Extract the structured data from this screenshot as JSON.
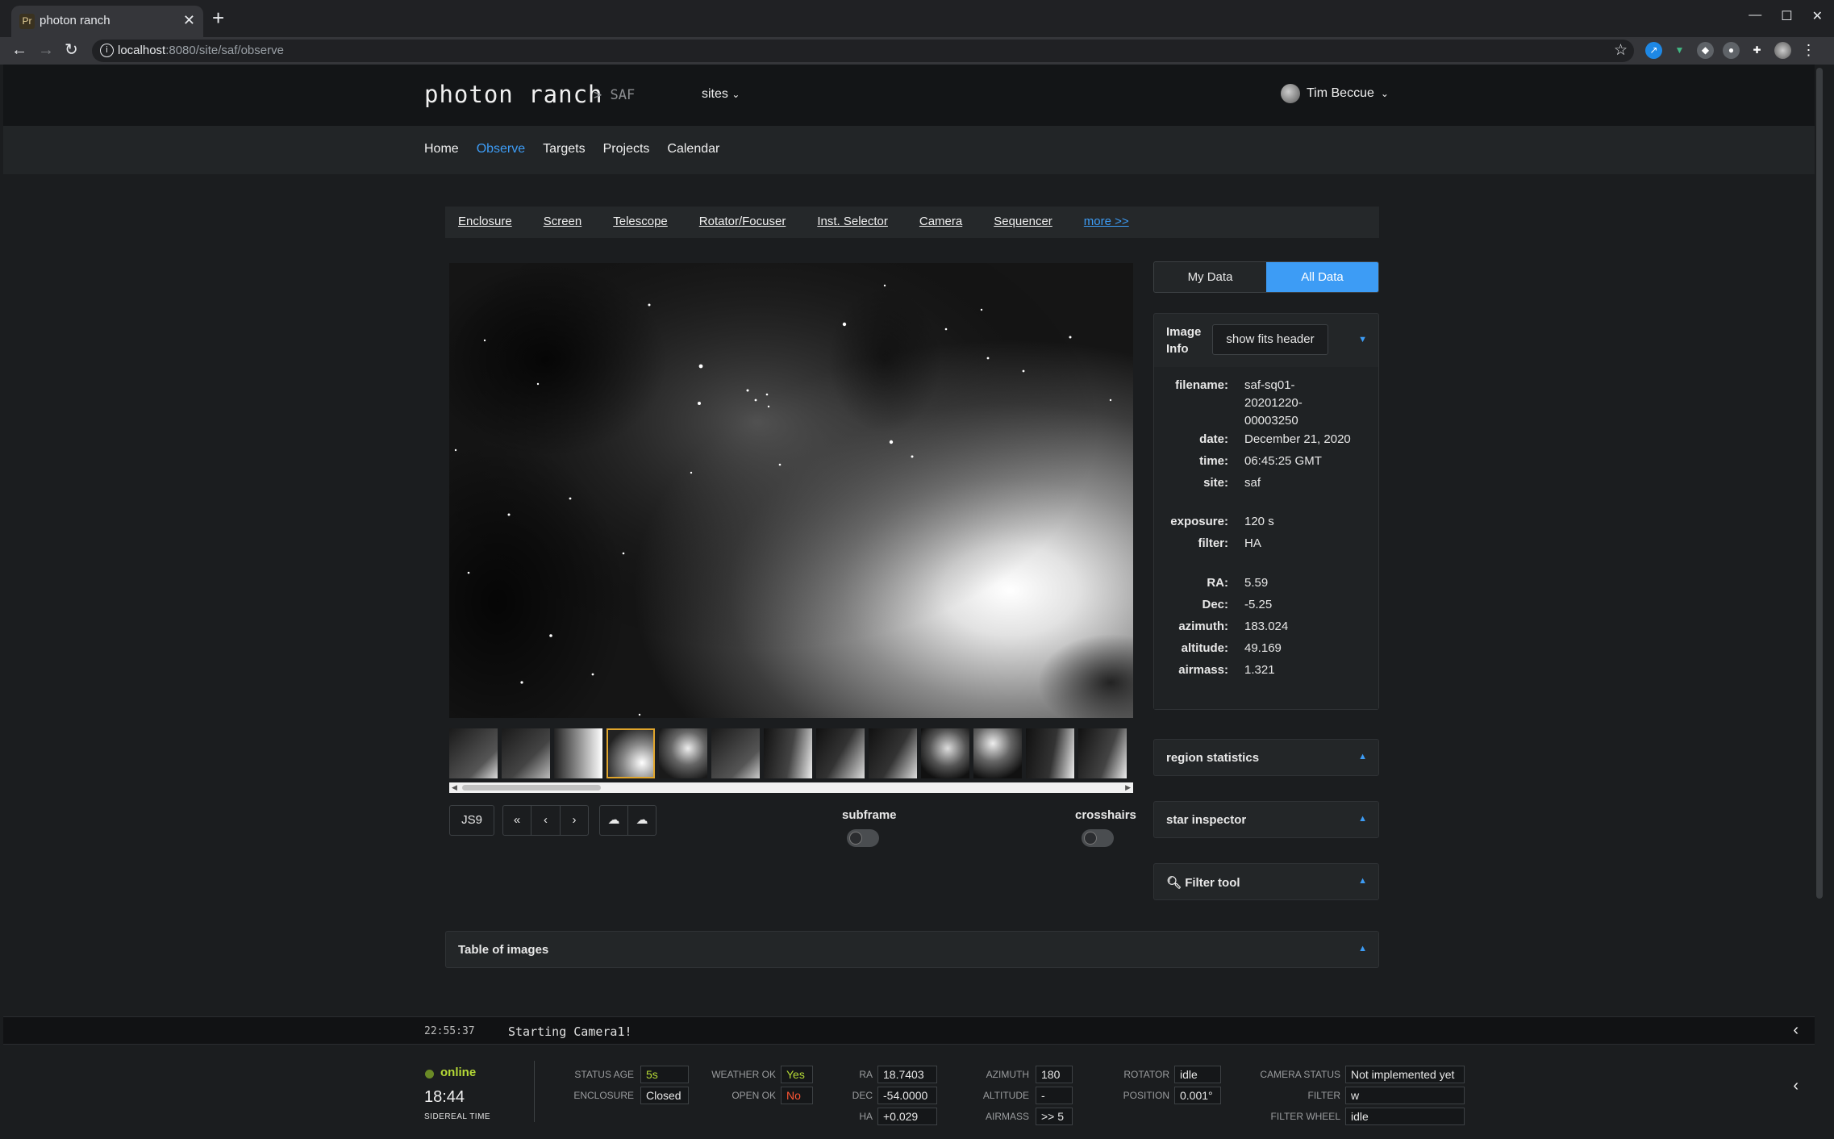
{
  "browser": {
    "tab_title": "photon ranch",
    "tab_favicon": "Pr",
    "url_host": "localhost",
    "url_rest": ":8080/site/saf/observe"
  },
  "header": {
    "logo": "photon ranch",
    "site_crumb": "> SAF",
    "sites_label": "sites",
    "user_name": "Tim Beccue"
  },
  "nav": {
    "items": [
      "Home",
      "Observe",
      "Targets",
      "Projects",
      "Calendar"
    ],
    "active": "Observe"
  },
  "subnav": {
    "items": [
      "Enclosure",
      "Screen",
      "Telescope",
      "Rotator/Focuser",
      "Inst. Selector",
      "Camera",
      "Sequencer"
    ],
    "more": "more >>"
  },
  "viewer": {
    "thumbnail_count": 13,
    "selected_thumbnail": 4
  },
  "controls": {
    "js9": "JS9",
    "subframe": "subframe",
    "crosshairs": "crosshairs"
  },
  "data_toggle": {
    "my_data": "My Data",
    "all_data": "All Data",
    "active": "All Data"
  },
  "image_info": {
    "title_line1": "Image",
    "title_line2": "Info",
    "fits_button": "show fits header",
    "filename_key": "filename:",
    "filename_l1": "saf-sq01-",
    "filename_l2": "20201220-",
    "filename_l3": "00003250",
    "fields": [
      {
        "k": "date:",
        "v": "December 21, 2020"
      },
      {
        "k": "time:",
        "v": "06:45:25 GMT"
      },
      {
        "k": "site:",
        "v": "saf"
      },
      {
        "k": "exposure:",
        "v": "120 s"
      },
      {
        "k": "filter:",
        "v": "HA"
      },
      {
        "k": "RA:",
        "v": "5.59"
      },
      {
        "k": "Dec:",
        "v": "-5.25"
      },
      {
        "k": "azimuth:",
        "v": "183.024"
      },
      {
        "k": "altitude:",
        "v": "49.169"
      },
      {
        "k": "airmass:",
        "v": "1.321"
      }
    ]
  },
  "panels": {
    "region_statistics": "region statistics",
    "star_inspector": "star inspector",
    "filter_tool": "Filter tool",
    "table_of_images": "Table of images"
  },
  "console": {
    "time": "22:55:37",
    "message": "Starting Camera1!"
  },
  "status": {
    "online": "online",
    "sidereal_time": "18:44",
    "sidereal_label": "SIDEREAL TIME",
    "status_age_label": "STATUS AGE",
    "status_age": "5s",
    "enclosure_label": "ENCLOSURE",
    "enclosure": "Closed",
    "weather_ok_label": "WEATHER OK",
    "weather_ok": "Yes",
    "open_ok_label": "OPEN OK",
    "open_ok": "No",
    "ra_label": "RA",
    "ra": "18.7403",
    "dec_label": "DEC",
    "dec": "-54.0000",
    "ha_label": "HA",
    "ha": "+0.029",
    "azimuth_label": "AZIMUTH",
    "azimuth": "180",
    "altitude_label": "ALTITUDE",
    "altitude": "-",
    "airmass_label": "AIRMASS",
    "airmass": ">> 5",
    "rotator_label": "ROTATOR",
    "rotator": "idle",
    "position_label": "POSITION",
    "position": "0.001°",
    "camera_status_label": "CAMERA STATUS",
    "camera_status": "Not implemented yet",
    "filter_label": "FILTER",
    "filter": "w",
    "filter_wheel_label": "FILTER WHEEL",
    "filter_wheel": "idle"
  },
  "colors": {
    "accent": "#3d9cf5",
    "online": "#b5d936",
    "alert": "#ff5533",
    "selected_thumb": "#e0a52c"
  }
}
